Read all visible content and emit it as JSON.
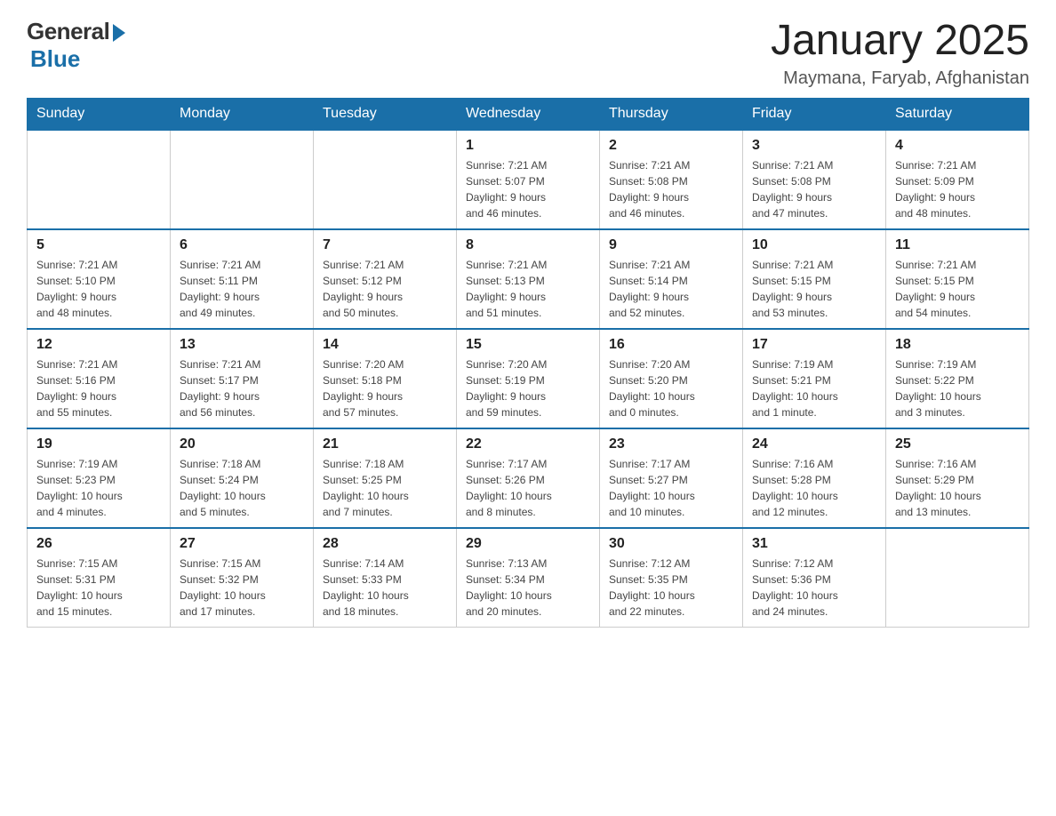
{
  "header": {
    "logo_general": "General",
    "logo_blue": "Blue",
    "title": "January 2025",
    "location": "Maymana, Faryab, Afghanistan"
  },
  "days_of_week": [
    "Sunday",
    "Monday",
    "Tuesday",
    "Wednesday",
    "Thursday",
    "Friday",
    "Saturday"
  ],
  "weeks": [
    [
      {
        "day": "",
        "info": ""
      },
      {
        "day": "",
        "info": ""
      },
      {
        "day": "",
        "info": ""
      },
      {
        "day": "1",
        "info": "Sunrise: 7:21 AM\nSunset: 5:07 PM\nDaylight: 9 hours\nand 46 minutes."
      },
      {
        "day": "2",
        "info": "Sunrise: 7:21 AM\nSunset: 5:08 PM\nDaylight: 9 hours\nand 46 minutes."
      },
      {
        "day": "3",
        "info": "Sunrise: 7:21 AM\nSunset: 5:08 PM\nDaylight: 9 hours\nand 47 minutes."
      },
      {
        "day": "4",
        "info": "Sunrise: 7:21 AM\nSunset: 5:09 PM\nDaylight: 9 hours\nand 48 minutes."
      }
    ],
    [
      {
        "day": "5",
        "info": "Sunrise: 7:21 AM\nSunset: 5:10 PM\nDaylight: 9 hours\nand 48 minutes."
      },
      {
        "day": "6",
        "info": "Sunrise: 7:21 AM\nSunset: 5:11 PM\nDaylight: 9 hours\nand 49 minutes."
      },
      {
        "day": "7",
        "info": "Sunrise: 7:21 AM\nSunset: 5:12 PM\nDaylight: 9 hours\nand 50 minutes."
      },
      {
        "day": "8",
        "info": "Sunrise: 7:21 AM\nSunset: 5:13 PM\nDaylight: 9 hours\nand 51 minutes."
      },
      {
        "day": "9",
        "info": "Sunrise: 7:21 AM\nSunset: 5:14 PM\nDaylight: 9 hours\nand 52 minutes."
      },
      {
        "day": "10",
        "info": "Sunrise: 7:21 AM\nSunset: 5:15 PM\nDaylight: 9 hours\nand 53 minutes."
      },
      {
        "day": "11",
        "info": "Sunrise: 7:21 AM\nSunset: 5:15 PM\nDaylight: 9 hours\nand 54 minutes."
      }
    ],
    [
      {
        "day": "12",
        "info": "Sunrise: 7:21 AM\nSunset: 5:16 PM\nDaylight: 9 hours\nand 55 minutes."
      },
      {
        "day": "13",
        "info": "Sunrise: 7:21 AM\nSunset: 5:17 PM\nDaylight: 9 hours\nand 56 minutes."
      },
      {
        "day": "14",
        "info": "Sunrise: 7:20 AM\nSunset: 5:18 PM\nDaylight: 9 hours\nand 57 minutes."
      },
      {
        "day": "15",
        "info": "Sunrise: 7:20 AM\nSunset: 5:19 PM\nDaylight: 9 hours\nand 59 minutes."
      },
      {
        "day": "16",
        "info": "Sunrise: 7:20 AM\nSunset: 5:20 PM\nDaylight: 10 hours\nand 0 minutes."
      },
      {
        "day": "17",
        "info": "Sunrise: 7:19 AM\nSunset: 5:21 PM\nDaylight: 10 hours\nand 1 minute."
      },
      {
        "day": "18",
        "info": "Sunrise: 7:19 AM\nSunset: 5:22 PM\nDaylight: 10 hours\nand 3 minutes."
      }
    ],
    [
      {
        "day": "19",
        "info": "Sunrise: 7:19 AM\nSunset: 5:23 PM\nDaylight: 10 hours\nand 4 minutes."
      },
      {
        "day": "20",
        "info": "Sunrise: 7:18 AM\nSunset: 5:24 PM\nDaylight: 10 hours\nand 5 minutes."
      },
      {
        "day": "21",
        "info": "Sunrise: 7:18 AM\nSunset: 5:25 PM\nDaylight: 10 hours\nand 7 minutes."
      },
      {
        "day": "22",
        "info": "Sunrise: 7:17 AM\nSunset: 5:26 PM\nDaylight: 10 hours\nand 8 minutes."
      },
      {
        "day": "23",
        "info": "Sunrise: 7:17 AM\nSunset: 5:27 PM\nDaylight: 10 hours\nand 10 minutes."
      },
      {
        "day": "24",
        "info": "Sunrise: 7:16 AM\nSunset: 5:28 PM\nDaylight: 10 hours\nand 12 minutes."
      },
      {
        "day": "25",
        "info": "Sunrise: 7:16 AM\nSunset: 5:29 PM\nDaylight: 10 hours\nand 13 minutes."
      }
    ],
    [
      {
        "day": "26",
        "info": "Sunrise: 7:15 AM\nSunset: 5:31 PM\nDaylight: 10 hours\nand 15 minutes."
      },
      {
        "day": "27",
        "info": "Sunrise: 7:15 AM\nSunset: 5:32 PM\nDaylight: 10 hours\nand 17 minutes."
      },
      {
        "day": "28",
        "info": "Sunrise: 7:14 AM\nSunset: 5:33 PM\nDaylight: 10 hours\nand 18 minutes."
      },
      {
        "day": "29",
        "info": "Sunrise: 7:13 AM\nSunset: 5:34 PM\nDaylight: 10 hours\nand 20 minutes."
      },
      {
        "day": "30",
        "info": "Sunrise: 7:12 AM\nSunset: 5:35 PM\nDaylight: 10 hours\nand 22 minutes."
      },
      {
        "day": "31",
        "info": "Sunrise: 7:12 AM\nSunset: 5:36 PM\nDaylight: 10 hours\nand 24 minutes."
      },
      {
        "day": "",
        "info": ""
      }
    ]
  ]
}
